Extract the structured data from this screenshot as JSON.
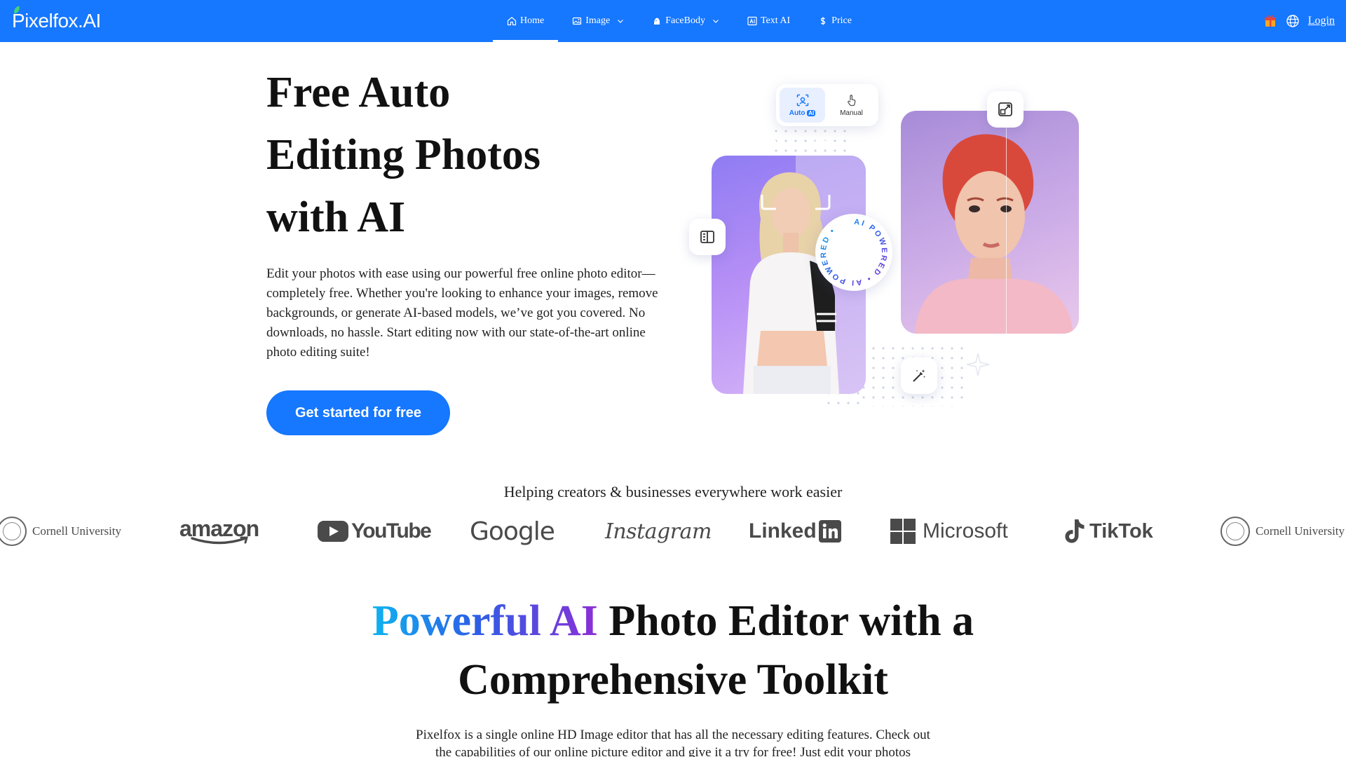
{
  "nav": {
    "logo": "Pixelfox.AI",
    "items": [
      {
        "label": "Home",
        "icon": "home-icon",
        "dropdown": false,
        "active": true
      },
      {
        "label": "Image",
        "icon": "image-icon",
        "dropdown": true,
        "active": false
      },
      {
        "label": "FaceBody",
        "icon": "face-icon",
        "dropdown": true,
        "active": false
      },
      {
        "label": "Text AI",
        "icon": "text-ai-icon",
        "dropdown": false,
        "active": false
      },
      {
        "label": "Price",
        "icon": "dollar-icon",
        "dropdown": false,
        "active": false
      }
    ],
    "login": "Login"
  },
  "hero": {
    "title_line1": "Free Auto",
    "title_line2": "Editing Photos",
    "title_line3": "with AI",
    "description": "Edit your photos with ease using our powerful free online photo editor—completely free. Whether you're looking to enhance your images, remove backgrounds, or generate AI-based models, we’ve got you covered. No downloads, no hassle. Start editing now with our state-of-the-art online photo editing suite!",
    "cta": "Get started for free",
    "visual": {
      "mode_auto": "Auto",
      "mode_auto_badge": "AI",
      "mode_manual": "Manual",
      "badge_text": "AI POWERED • AI POWERED •"
    }
  },
  "trust": {
    "heading": "Helping creators & businesses everywhere work easier",
    "brands": [
      "Cornell University",
      "amazon",
      "YouTube",
      "Google",
      "Instagram",
      "Linked",
      "Microsoft",
      "TikTok",
      "Cornell University"
    ]
  },
  "section2": {
    "title_highlight": "Powerful AI",
    "title_rest": "Photo Editor with a",
    "title_line2": "Comprehensive Toolkit",
    "description": "Pixelfox is a single online HD Image editor that has all the necessary editing features. Check out the capabilities of our online picture editor and give it a try for free! Just edit your photos"
  },
  "colors": {
    "primary": "#1677ff",
    "gradient_start": "#0fb3f0",
    "gradient_end": "#8b2fd6"
  }
}
